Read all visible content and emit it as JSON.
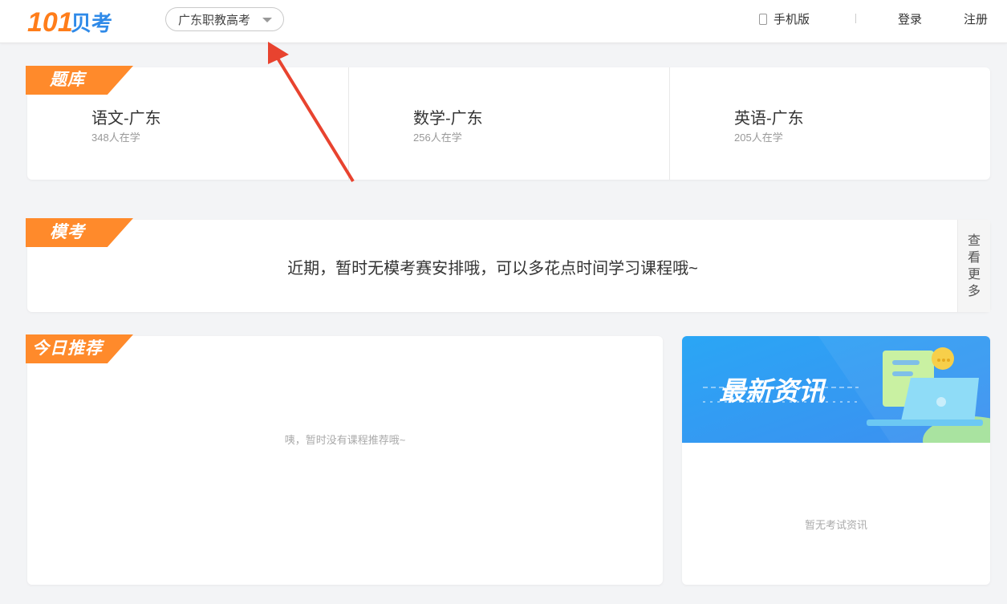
{
  "header": {
    "logo_text": "101贝考",
    "region": "广东职教高考",
    "mobile_label": "手机版",
    "login": "登录",
    "register": "注册"
  },
  "question_bank": {
    "title": "题库",
    "subjects": [
      {
        "name": "语文-广东",
        "learners": "348人在学"
      },
      {
        "name": "数学-广东",
        "learners": "256人在学"
      },
      {
        "name": "英语-广东",
        "learners": "205人在学"
      }
    ]
  },
  "mock_exam": {
    "title": "模考",
    "message": "近期，暂时无模考赛安排哦，可以多花点时间学习课程哦~",
    "more_chars": [
      "查",
      "看",
      "更",
      "多"
    ]
  },
  "today_recommend": {
    "title": "今日推荐",
    "empty_message": "咦，暂时没有课程推荐哦~"
  },
  "news": {
    "banner_title": "最新资讯",
    "empty_message": "暂无考试资讯"
  },
  "colors": {
    "accent_orange": "#ff8a2b",
    "logo_blue": "#2f8ae8",
    "annotation_red": "#e8432f"
  }
}
